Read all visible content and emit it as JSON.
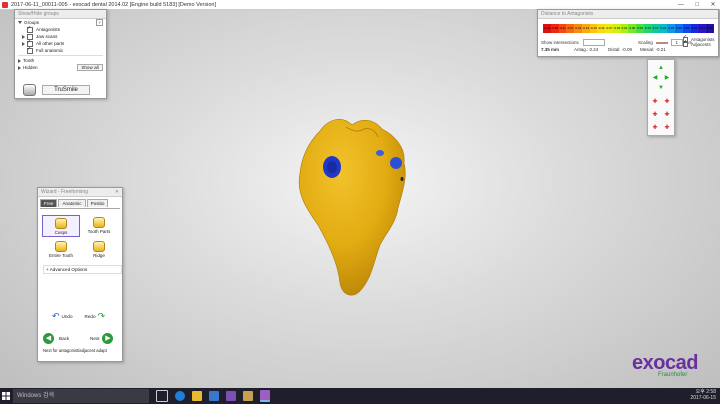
{
  "window": {
    "title": "2017-06-11_00011-005 - exocad dental 2014.02 [Engine build 5183] [Demo Version]"
  },
  "showhide": {
    "header": "Show/Hide groups",
    "groups_label": "Groups",
    "items": [
      "Antagonists",
      "Jaw scans",
      "All other parts",
      "Full anatomic"
    ],
    "tooth_label": "Tooth",
    "hidden_label": "Hidden",
    "show_all": "Show all",
    "brand": "TruSmile"
  },
  "distance": {
    "header": "Distance to Antagonists",
    "scale_values": [
      "-0.41",
      "-0.35",
      "-0.31",
      "-0.27",
      "-0.23",
      "-0.19",
      "-0.15",
      "-0.11",
      "-0.07",
      "-0.03",
      "0.01",
      "0.05",
      "0.09",
      "0.13",
      "0.17",
      "0.21",
      "0.25",
      "0.29",
      "0.33",
      "0.37",
      "0.41",
      "0.45"
    ],
    "scale_colors": [
      "#e01010",
      "#ec2a10",
      "#f44a10",
      "#f86a10",
      "#fa8a10",
      "#fca810",
      "#fcc410",
      "#f8dc10",
      "#eaec10",
      "#cdf010",
      "#a8f010",
      "#78e820",
      "#48e040",
      "#20d868",
      "#10c898",
      "#10b8c8",
      "#1098e8",
      "#1070f0",
      "#1048f0",
      "#1828e0",
      "#2818c8",
      "#2010a8"
    ],
    "show_intersections": "Show intersections",
    "scaling_label": "Scaling",
    "scaling_value": "1",
    "mm_label": "mm",
    "antagonists_cb": "Antagonists",
    "adjacents_cb": "Adjacents",
    "min_value": "7.35 mm",
    "antag_value": "Antag.: 0.24",
    "distal_value": "Distal: -0.09",
    "mesial_value": "Mesial: -0.21"
  },
  "wizard": {
    "header": "Wizard - Freeforming",
    "tabs": [
      "Free",
      "Anatomic",
      "Positio"
    ],
    "tools": [
      "Cusps",
      "Tooth Parts",
      "Entire Tooth",
      "Ridge"
    ],
    "advanced": "+ Advanced Options",
    "undo": "Undo",
    "redo": "Redo",
    "back": "Back",
    "next": "Next",
    "footer": "Next for antagonist/adjacent adapt"
  },
  "logo": {
    "main": "exocad",
    "sub": "Fraunhofer"
  },
  "taskbar": {
    "search_placeholder": "Windows 검색",
    "time": "오후 2:58",
    "date": "2017-06-15"
  }
}
